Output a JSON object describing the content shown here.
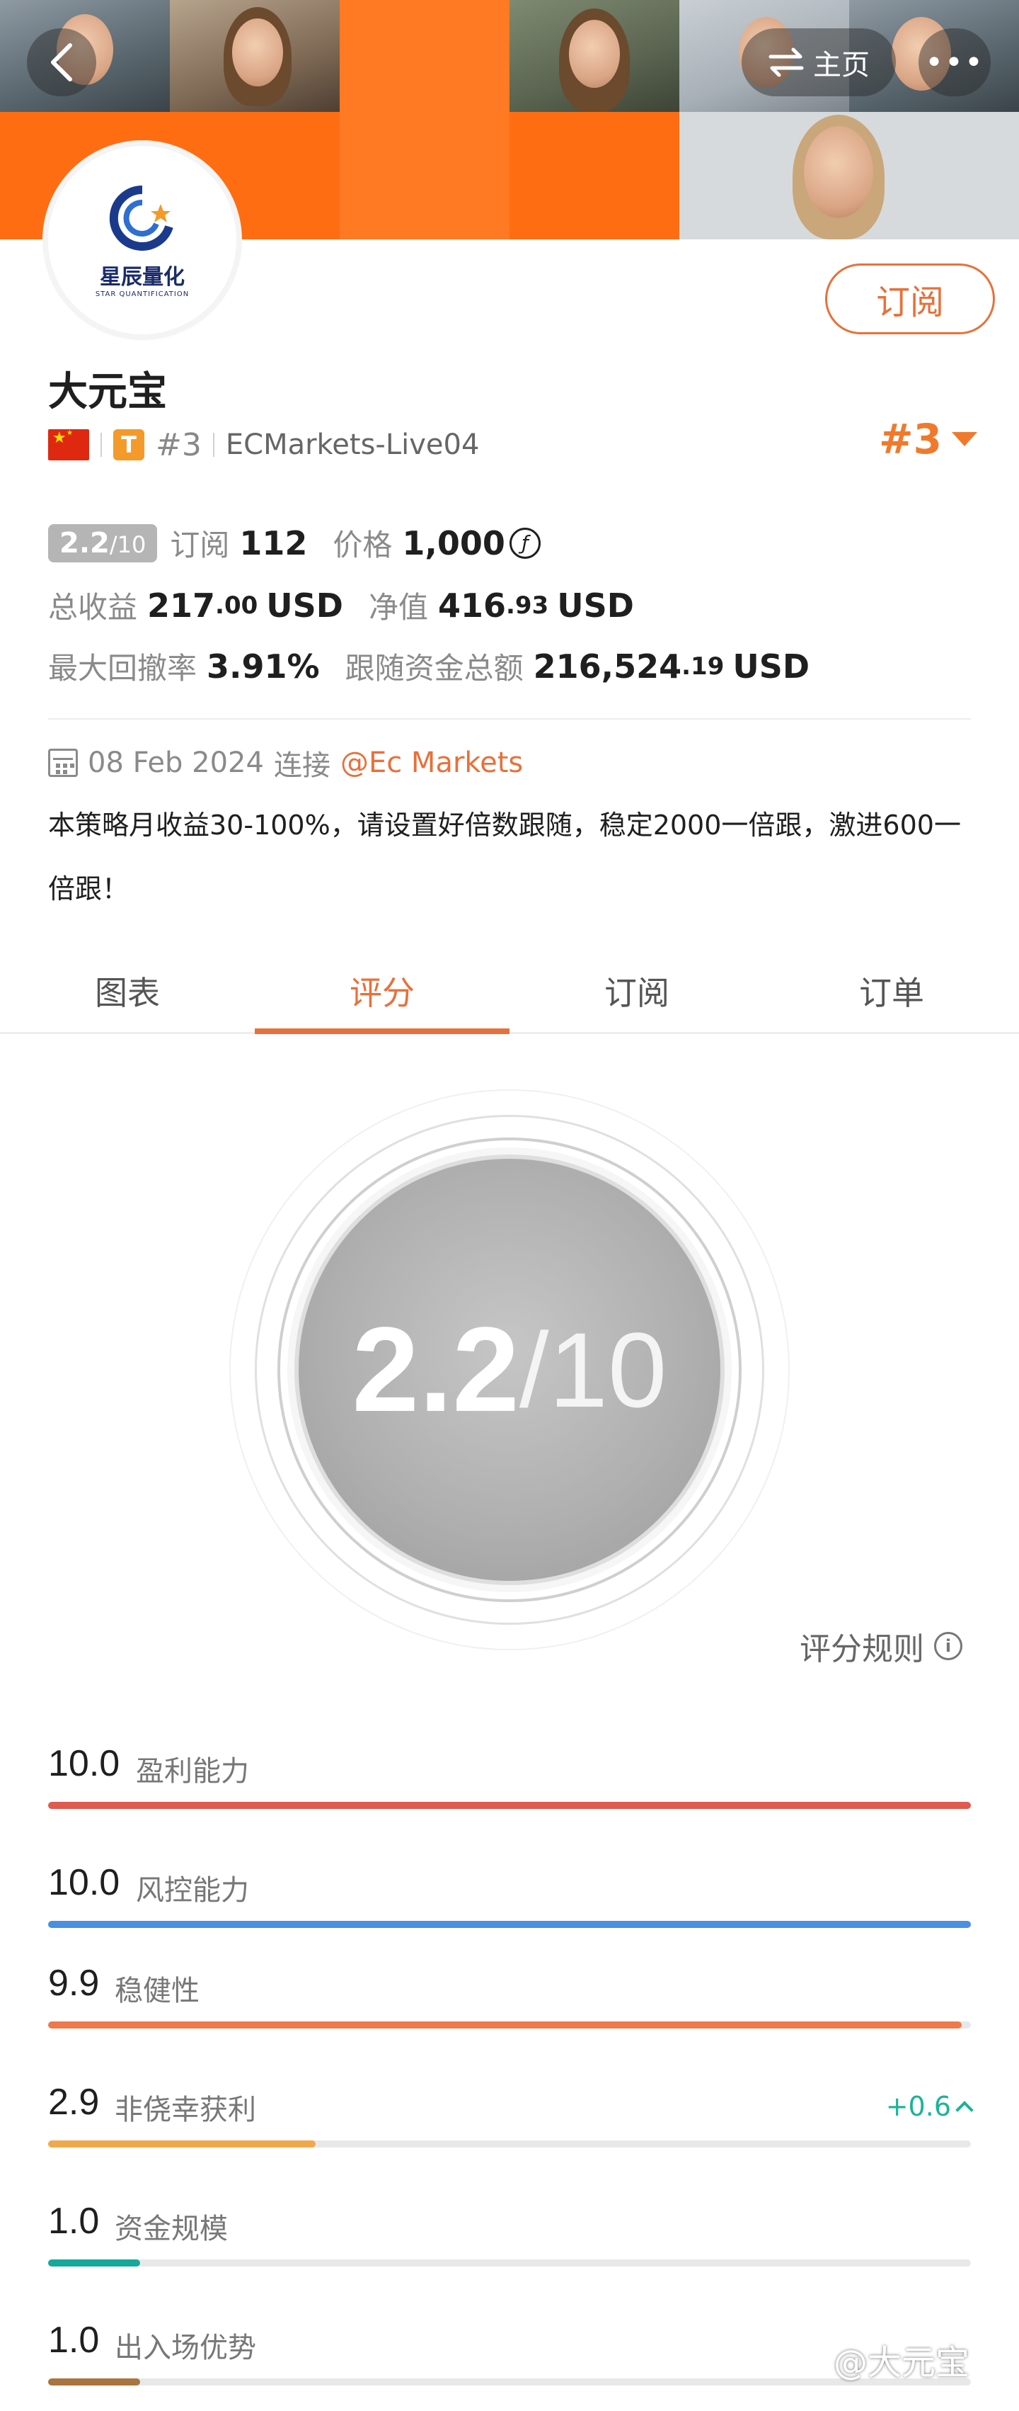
{
  "nav": {
    "home_label": "主页",
    "more_label": "•••"
  },
  "avatar": {
    "logo_text": "星辰量化",
    "logo_sub": "STAR QUANTIFICATION"
  },
  "subscribe_label": "订阅",
  "profile": {
    "name": "大元宝",
    "country_flag": "CN",
    "badge_letter": "T",
    "rank": "#3",
    "account": "ECMarkets-Live04",
    "rank_big": "#3"
  },
  "stats": {
    "score": "2.2",
    "score_max": "/10",
    "subscribe_label": "订阅",
    "subscribe_count": "112",
    "price_label": "价格",
    "price_value": "1,000",
    "price_icon": "ƒ",
    "total_profit_label": "总收益",
    "total_profit_int": "217",
    "total_profit_dec": ".00",
    "total_profit_unit": "USD",
    "net_value_label": "净值",
    "net_value_int": "416",
    "net_value_dec": ".93",
    "net_value_unit": "USD",
    "max_drawdown_label": "最大回撤率",
    "max_drawdown_value": "3.91%",
    "follow_funds_label": "跟随资金总额",
    "follow_funds_int": "216,524",
    "follow_funds_dec": ".19",
    "follow_funds_unit": "USD"
  },
  "connection": {
    "date": "08 Feb 2024",
    "connect_label": "连接",
    "broker": "@Ec Markets"
  },
  "description": "本策略月收益30-100%，请设置好倍数跟随，稳定2000一倍跟，激进600一倍跟！",
  "tabs": [
    {
      "label": "图表",
      "active": false
    },
    {
      "label": "评分",
      "active": true
    },
    {
      "label": "订阅",
      "active": false
    },
    {
      "label": "订单",
      "active": false
    }
  ],
  "dial": {
    "score": "2.2",
    "max": "/10"
  },
  "rules_label": "评分规则",
  "metrics": [
    {
      "value": "10.0",
      "label": "盈利能力",
      "fraction": 1.0,
      "color": "#e05a4f"
    },
    {
      "value": "10.0",
      "label": "风控能力",
      "fraction": 1.0,
      "color": "#4a8fe0"
    },
    {
      "value": "9.9",
      "label": "稳健性",
      "fraction": 0.99,
      "color": "#ee7a4c"
    },
    {
      "value": "2.9",
      "label": "非侥幸获利",
      "fraction": 0.29,
      "color": "#efa94c",
      "delta": "+0.6"
    },
    {
      "value": "1.0",
      "label": "资金规模",
      "fraction": 0.1,
      "color": "#16a89a"
    },
    {
      "value": "1.0",
      "label": "出入场优势",
      "fraction": 0.1,
      "color": "#a8743f"
    }
  ],
  "watermark": "@大元宝"
}
